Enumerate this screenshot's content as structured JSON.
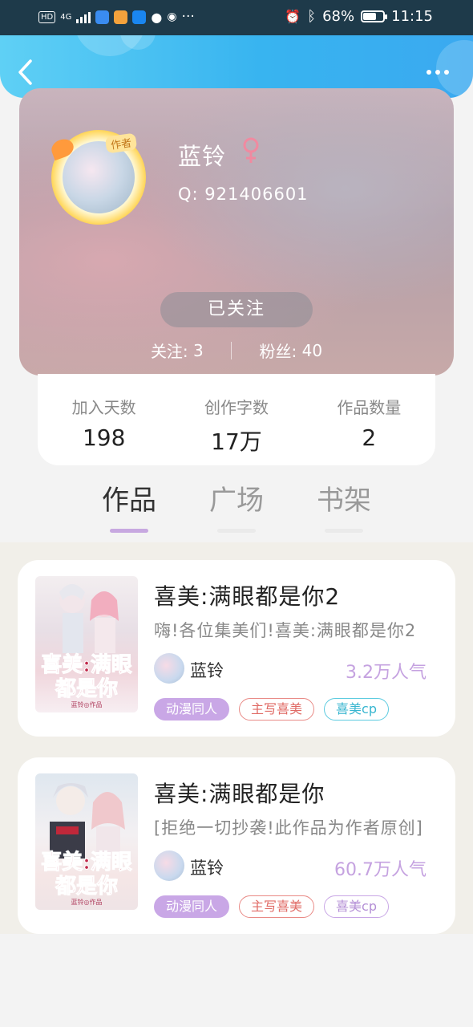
{
  "status_bar": {
    "network": "4G",
    "battery": "68%",
    "battery_level": 0.68,
    "time": "11:15",
    "more_dots": "···"
  },
  "colors": {
    "header": "#38b4f0",
    "accent": "#c9a7e6",
    "popularity": "#c5a2e0"
  },
  "profile": {
    "author_badge": "作者",
    "name": "蓝铃",
    "gender_icon": "female-icon",
    "qq_label": "Q:",
    "qq_value": "921406601",
    "follow_button": "已关注",
    "following_label": "关注:",
    "following_count": "3",
    "fans_label": "粉丝:",
    "fans_count": "40"
  },
  "stats": [
    {
      "label": "加入天数",
      "value": "198"
    },
    {
      "label": "创作字数",
      "value": "17万"
    },
    {
      "label": "作品数量",
      "value": "2"
    }
  ],
  "tabs": [
    {
      "label": "作品",
      "active": true
    },
    {
      "label": "广场",
      "active": false
    },
    {
      "label": "书架",
      "active": false
    }
  ],
  "books": [
    {
      "title": "喜美:满眼都是你2",
      "description": "嗨!各位集美们!喜美:满眼都是你2",
      "author": "蓝铃",
      "popularity": "3.2万人气",
      "cover_title": "喜美:满眼都是你",
      "cover_sub": "蓝铃◎作品",
      "tags": [
        "动漫同人",
        "主写喜美",
        "喜美cp"
      ]
    },
    {
      "title": "喜美:满眼都是你",
      "description": "[拒绝一切抄袭!此作品为作者原创]",
      "author": "蓝铃",
      "popularity": "60.7万人气",
      "cover_title": "喜美:满眼都是你",
      "cover_sub": "蓝铃◎作品",
      "tags": [
        "动漫同人",
        "主写喜美",
        "喜美cp"
      ]
    }
  ]
}
